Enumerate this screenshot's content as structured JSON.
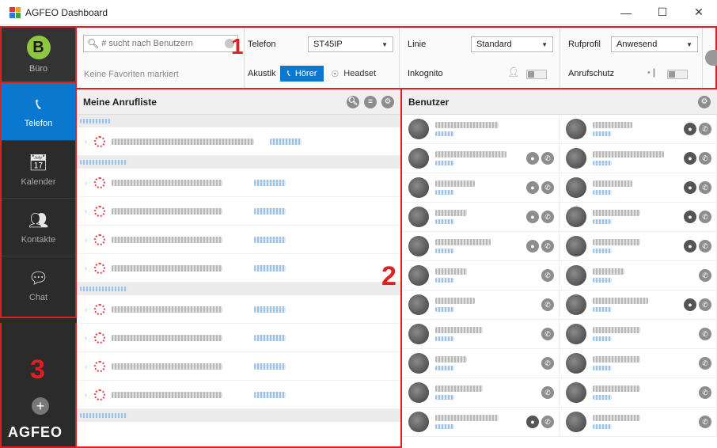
{
  "window": {
    "title": "AGFEO Dashboard",
    "min": "—",
    "max": "☐",
    "close": "✕"
  },
  "sidebar": {
    "user_initial": "B",
    "user_label": "Büro",
    "items": [
      {
        "label": "Telefon",
        "icon": "📞"
      },
      {
        "label": "Kalender",
        "icon": "📅"
      },
      {
        "label": "Kontakte",
        "icon": "👥"
      },
      {
        "label": "Chat",
        "icon": "💬"
      }
    ],
    "add": "+",
    "brand": "AGFEO"
  },
  "toolbar": {
    "search_placeholder": "# sucht nach Benutzern",
    "favorites_text": "Keine Favoriten markiert",
    "telefon_label": "Telefon",
    "telefon_value": "ST45IP",
    "akustik_label": "Akustik",
    "hoerer_label": "Hörer",
    "headset_label": "Headset",
    "linie_label": "Linie",
    "linie_value": "Standard",
    "inkognito_label": "Inkognito",
    "rufprofil_label": "Rufprofil",
    "rufprofil_value": "Anwesend",
    "anrufschutz_label": "Anrufschutz"
  },
  "calls": {
    "title": "Meine Anrufliste"
  },
  "users": {
    "title": "Benutzer"
  },
  "annotations": {
    "n1": "1",
    "n2": "2",
    "n3": "3"
  }
}
